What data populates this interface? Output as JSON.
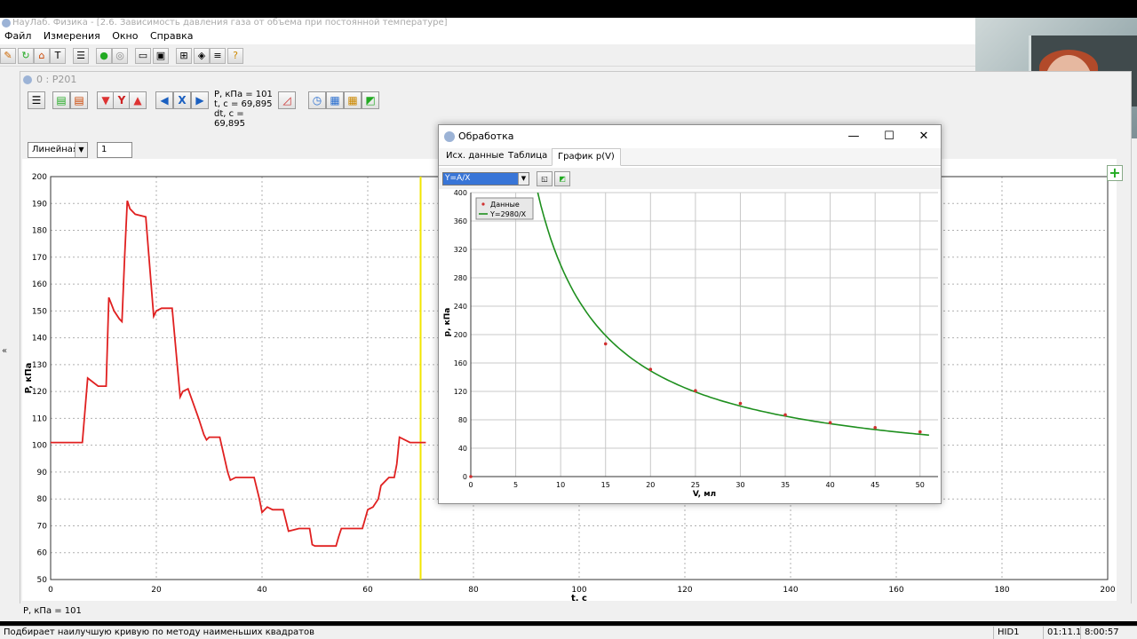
{
  "window": {
    "title": "НауЛаб. Физика - [2.6. Зависимость давления газа от объема при постоянной температуре]"
  },
  "menu": [
    "Файл",
    "Измерения",
    "Окно",
    "Справка"
  ],
  "child_window": {
    "title": "0 : P201"
  },
  "readout": {
    "p": "P, кПа = 101",
    "t": "t, с = 69,895",
    "dt": "dt, с = 69,895"
  },
  "child_toolbar": {
    "y_label": "Y",
    "x_label": "X"
  },
  "scale_mode": "Линейная",
  "scale_value": "1",
  "status_value": "P, кПа = 101",
  "status": {
    "hint": "Подбирает наилучшую кривую по методу наименьших квадратов",
    "device": "HID1",
    "elapsed": "01:11.1",
    "clock": "8:00:57"
  },
  "dialog": {
    "title": "Обработка",
    "tabs": [
      "Исх. данные",
      "Таблица",
      "График p(V)"
    ],
    "active_tab": 2,
    "fit_model": "Y=A/X",
    "controls": {
      "minimize": "—",
      "maximize": "☐",
      "close": "✕"
    }
  },
  "colors": {
    "main_series": "#e02020",
    "fit_series": "#1e8f1e",
    "cursor": "#f2e600",
    "data_points": "#d03030"
  },
  "chart_data": [
    {
      "type": "line",
      "xlabel": "t, с",
      "ylabel": "P, кПа",
      "xlim": [
        0,
        200
      ],
      "ylim": [
        50,
        200
      ],
      "x_ticks": [
        0,
        20,
        40,
        60,
        80,
        100,
        120,
        140,
        160,
        180,
        200
      ],
      "y_ticks": [
        50,
        60,
        70,
        80,
        90,
        100,
        110,
        120,
        130,
        140,
        150,
        160,
        170,
        180,
        190,
        200
      ],
      "grid": true,
      "cursor_x": 70,
      "series": [
        {
          "x": [
            0,
            6,
            7,
            9,
            10.5,
            11,
            12,
            13,
            13.5,
            14,
            14.5,
            15,
            16,
            18,
            19.5,
            20,
            21,
            23,
            24.5,
            25,
            26,
            28,
            29,
            29.5,
            30,
            32,
            33.5,
            34,
            35,
            38.5,
            39.5,
            40,
            41,
            42,
            44,
            44.5,
            45,
            47,
            49,
            49.5,
            50,
            54,
            54.5,
            55,
            59,
            60,
            61,
            62,
            62.5,
            64,
            65,
            65.5,
            66,
            68,
            71
          ],
          "y": [
            101,
            101,
            125,
            122,
            122,
            155,
            150,
            147,
            146,
            170,
            191,
            188,
            186,
            185,
            148,
            150,
            151,
            151,
            118,
            120,
            121,
            110,
            104,
            102,
            103,
            103,
            90,
            87,
            88,
            88,
            80,
            75,
            77,
            76,
            76,
            72,
            68,
            69,
            69,
            63,
            62.5,
            62.5,
            66,
            69,
            69,
            76,
            77,
            80,
            85,
            88,
            88,
            93,
            103,
            101,
            101
          ]
        }
      ]
    },
    {
      "type": "scatter",
      "xlabel": "V, мл",
      "ylabel": "p, кПа",
      "xlim": [
        0,
        52
      ],
      "ylim": [
        0,
        400
      ],
      "x_ticks": [
        0,
        5,
        10,
        15,
        20,
        25,
        30,
        35,
        40,
        45,
        50
      ],
      "y_ticks": [
        0,
        40,
        80,
        120,
        160,
        200,
        240,
        280,
        320,
        360,
        400
      ],
      "grid": true,
      "legend": {
        "placement": "top-left",
        "entries": [
          "Данные",
          "Y=2980/X"
        ]
      },
      "series": [
        {
          "name": "Данные",
          "x": [
            0,
            15,
            20,
            25,
            30,
            35,
            40,
            45,
            50
          ],
          "y": [
            0,
            187,
            151,
            121,
            103,
            87,
            76,
            69,
            63
          ]
        },
        {
          "name": "Y=2980/X",
          "A": 2980,
          "x_start": 7.45,
          "x_end": 51
        }
      ]
    }
  ]
}
